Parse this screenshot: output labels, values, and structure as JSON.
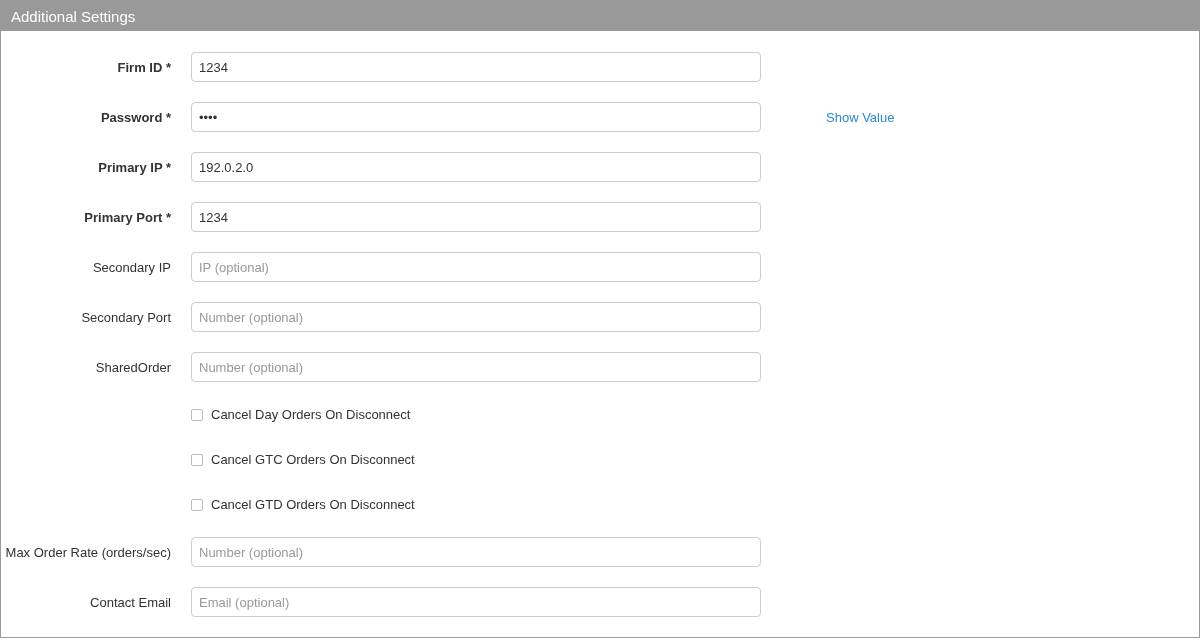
{
  "panel": {
    "title": "Additional Settings"
  },
  "rows": [
    {
      "kind": "field",
      "label": "Firm ID *",
      "required": true,
      "value": "1234"
    },
    {
      "kind": "field",
      "label": "Password *",
      "required": true,
      "value": "••••",
      "link": "Show Value"
    },
    {
      "kind": "field",
      "label": "Primary IP *",
      "required": true,
      "value": "192.0.2.0"
    },
    {
      "kind": "field",
      "label": "Primary Port *",
      "required": true,
      "value": "1234"
    },
    {
      "kind": "field",
      "label": "Secondary IP",
      "required": false,
      "placeholder": "IP (optional)"
    },
    {
      "kind": "field",
      "label": "Secondary Port",
      "required": false,
      "placeholder": "Number (optional)"
    },
    {
      "kind": "field",
      "label": "SharedOrder",
      "required": false,
      "placeholder": "Number (optional)"
    },
    {
      "kind": "checkbox",
      "label": "Cancel Day Orders On Disconnect",
      "checked": false
    },
    {
      "kind": "checkbox",
      "label": "Cancel GTC Orders On Disconnect",
      "checked": false
    },
    {
      "kind": "checkbox",
      "label": "Cancel GTD Orders On Disconnect",
      "checked": false
    },
    {
      "kind": "field",
      "label": "Max Order Rate (orders/sec)",
      "required": false,
      "placeholder": "Number (optional)"
    },
    {
      "kind": "field",
      "label": "Contact Email",
      "required": false,
      "placeholder": "Email (optional)"
    }
  ]
}
